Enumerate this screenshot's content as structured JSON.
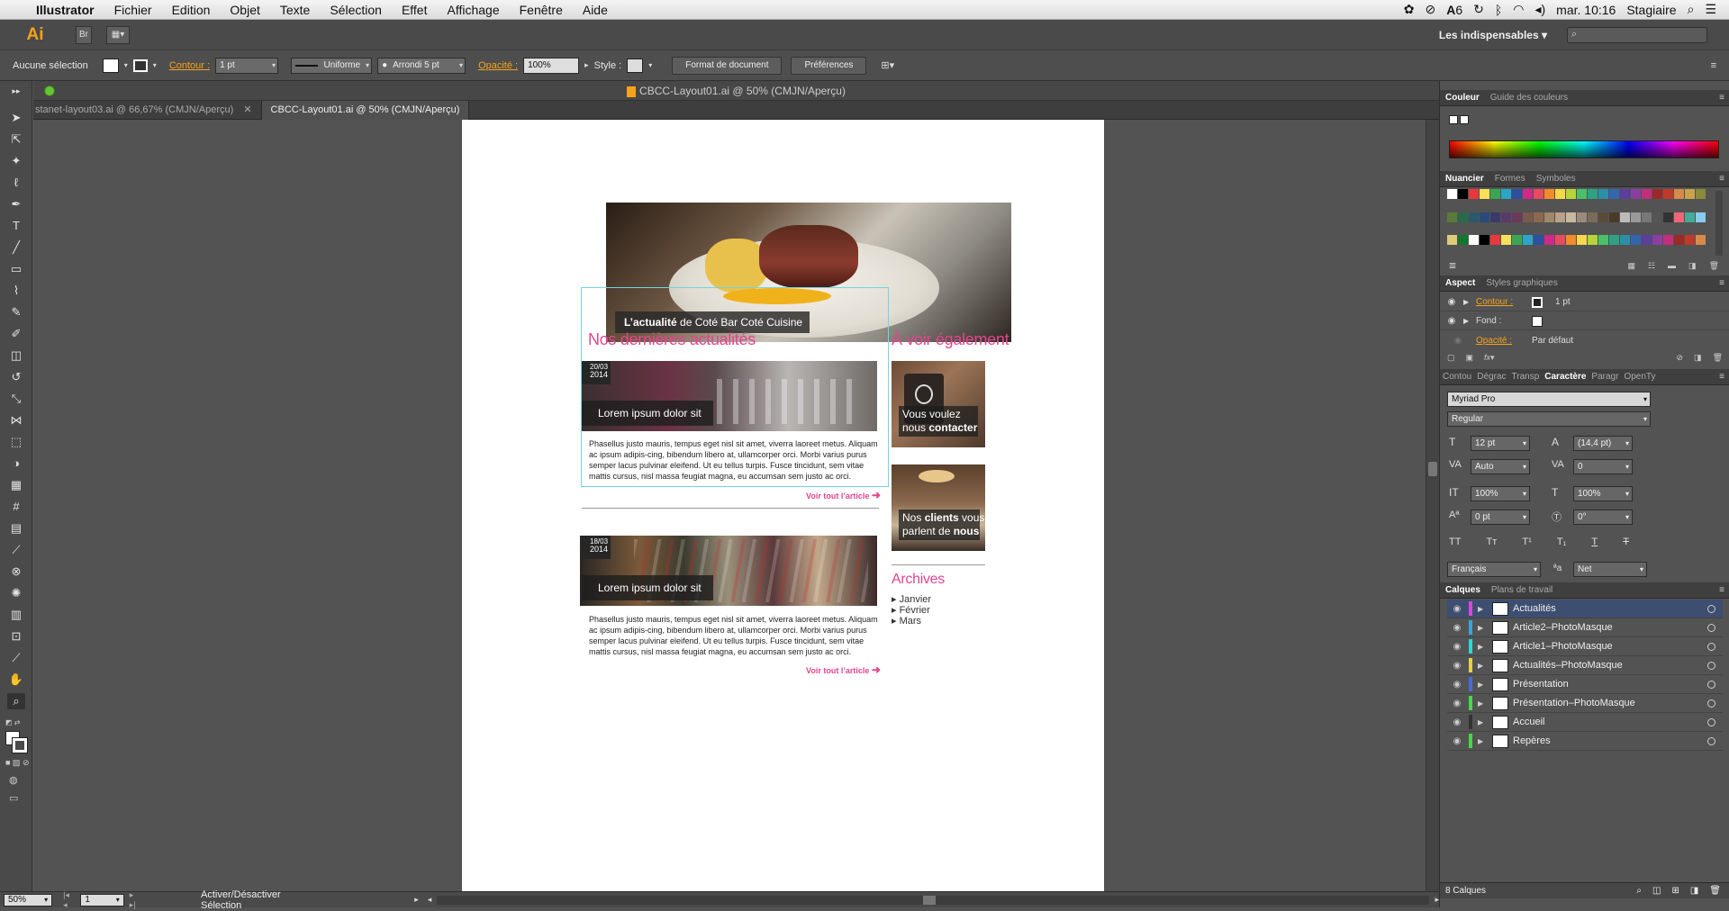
{
  "menubar": {
    "app": "Illustrator",
    "items": [
      "Fichier",
      "Edition",
      "Objet",
      "Texte",
      "Sélection",
      "Effet",
      "Affichage",
      "Fenêtre",
      "Aide"
    ],
    "battery_label": "6",
    "clock": "mar. 10:16",
    "user": "Stagiaire"
  },
  "appbar": {
    "logo": "Ai",
    "bridge": "Br",
    "workspace": "Les indispensables"
  },
  "control": {
    "selection": "Aucune sélection",
    "stroke_label": "Contour :",
    "stroke_value": "1 pt",
    "profile": "Uniforme",
    "brush": "Arrondi 5 pt",
    "opacity_label": "Opacité :",
    "opacity_value": "100%",
    "style_label": "Style :",
    "doc_format_btn": "Format de document",
    "prefs_btn": "Préférences"
  },
  "window_title": "CBCC-Layout01.ai @ 50% (CMJN/Aperçu)",
  "doc_tabs": [
    {
      "label": "stanet-layout03.ai @ 66,67% (CMJN/Aperçu)"
    },
    {
      "label": "CBCC-Layout01.ai @ 50% (CMJN/Aperçu)"
    }
  ],
  "artboard": {
    "hero_caption_bold": "L’actualité",
    "hero_caption_rest": " de Coté Bar Coté Cuisine",
    "news_heading": "Nos dernières actualités",
    "see_also_heading": "À voir également",
    "articles": [
      {
        "date_day": "20/03",
        "date_year": "2014",
        "title": "Lorem ipsum dolor sit",
        "body": "Phasellus justo mauris, tempus eget nisl sit amet, viverra laoreet metus. Aliquam ac ipsum adipis-cing, bibendum libero at, ullamcorper orci. Morbi varius purus semper lacus pulvinar eleifend. Ut eu tellus turpis. Fusce tincidunt, sem vitae mattis cursus, nisl massa feugiat magna, eu accumsan sem justo ac orci.",
        "more": "Voir tout l’article"
      },
      {
        "date_day": "18/03",
        "date_year": "2014",
        "title": "Lorem ipsum dolor sit",
        "body": "Phasellus justo mauris, tempus eget nisl sit amet, viverra laoreet metus. Aliquam ac ipsum adipis-cing, bibendum libero at, ullamcorper orci. Morbi varius purus semper lacus pulvinar eleifend. Ut eu tellus turpis. Fusce tincidunt, sem vitae mattis cursus, nisl massa feugiat magna, eu accumsan sem justo ac orci.",
        "more": "Voir tout l’article"
      }
    ],
    "side_cards": [
      {
        "line1": "Vous voulez",
        "line2_plain": "nous ",
        "line2_bold": "contacter"
      },
      {
        "line1_plain": "Nos ",
        "line1_bold": "clients",
        "line1_rest": " vous",
        "line2_plain": "parlent de ",
        "line2_bold": "nous"
      }
    ],
    "archives_heading": "Archives",
    "archives": [
      "Janvier",
      "Février",
      "Mars"
    ]
  },
  "panels": {
    "couleur_tabs": [
      "Couleur",
      "Guide des couleurs"
    ],
    "nuancier_tabs": [
      "Nuancier",
      "Formes",
      "Symboles"
    ],
    "aspect_tabs": [
      "Aspect",
      "Styles graphiques"
    ],
    "aspect_rows": [
      {
        "label": "Contour :",
        "value": "1 pt"
      },
      {
        "label": "Fond :",
        "value": ""
      },
      {
        "label": "Opacité :",
        "value": "Par défaut"
      }
    ],
    "char_tabs": [
      "Contou",
      "Dégrac",
      "Transp",
      "Caractère",
      "Paragr",
      "OpenTy"
    ],
    "font_family": "Myriad Pro",
    "font_style": "Regular",
    "font_size": "12 pt",
    "leading": "(14,4 pt)",
    "kerning": "Auto",
    "tracking": "0",
    "vscale": "100%",
    "hscale": "100%",
    "baseline": "0 pt",
    "rotation": "0°",
    "language": "Français",
    "antialias": "Net",
    "layers_tabs": [
      "Calques",
      "Plans de travail"
    ],
    "layers": [
      {
        "name": "Actualités",
        "color": "#d64bd6"
      },
      {
        "name": "Article2–PhotoMasque",
        "color": "#3aa6d6"
      },
      {
        "name": "Article1–PhotoMasque",
        "color": "#2fd6d6"
      },
      {
        "name": "Actualités–PhotoMasque",
        "color": "#e2d24a"
      },
      {
        "name": "Présentation",
        "color": "#4a6ad6"
      },
      {
        "name": "Présentation–PhotoMasque",
        "color": "#4ad64a"
      },
      {
        "name": "Accueil",
        "color": "#333333"
      },
      {
        "name": "Repères",
        "color": "#4ad64a"
      }
    ],
    "layers_count": "8 Calques"
  },
  "status": {
    "zoom": "50%",
    "page": "1",
    "mode": "Activer/Désactiver Sélection"
  }
}
